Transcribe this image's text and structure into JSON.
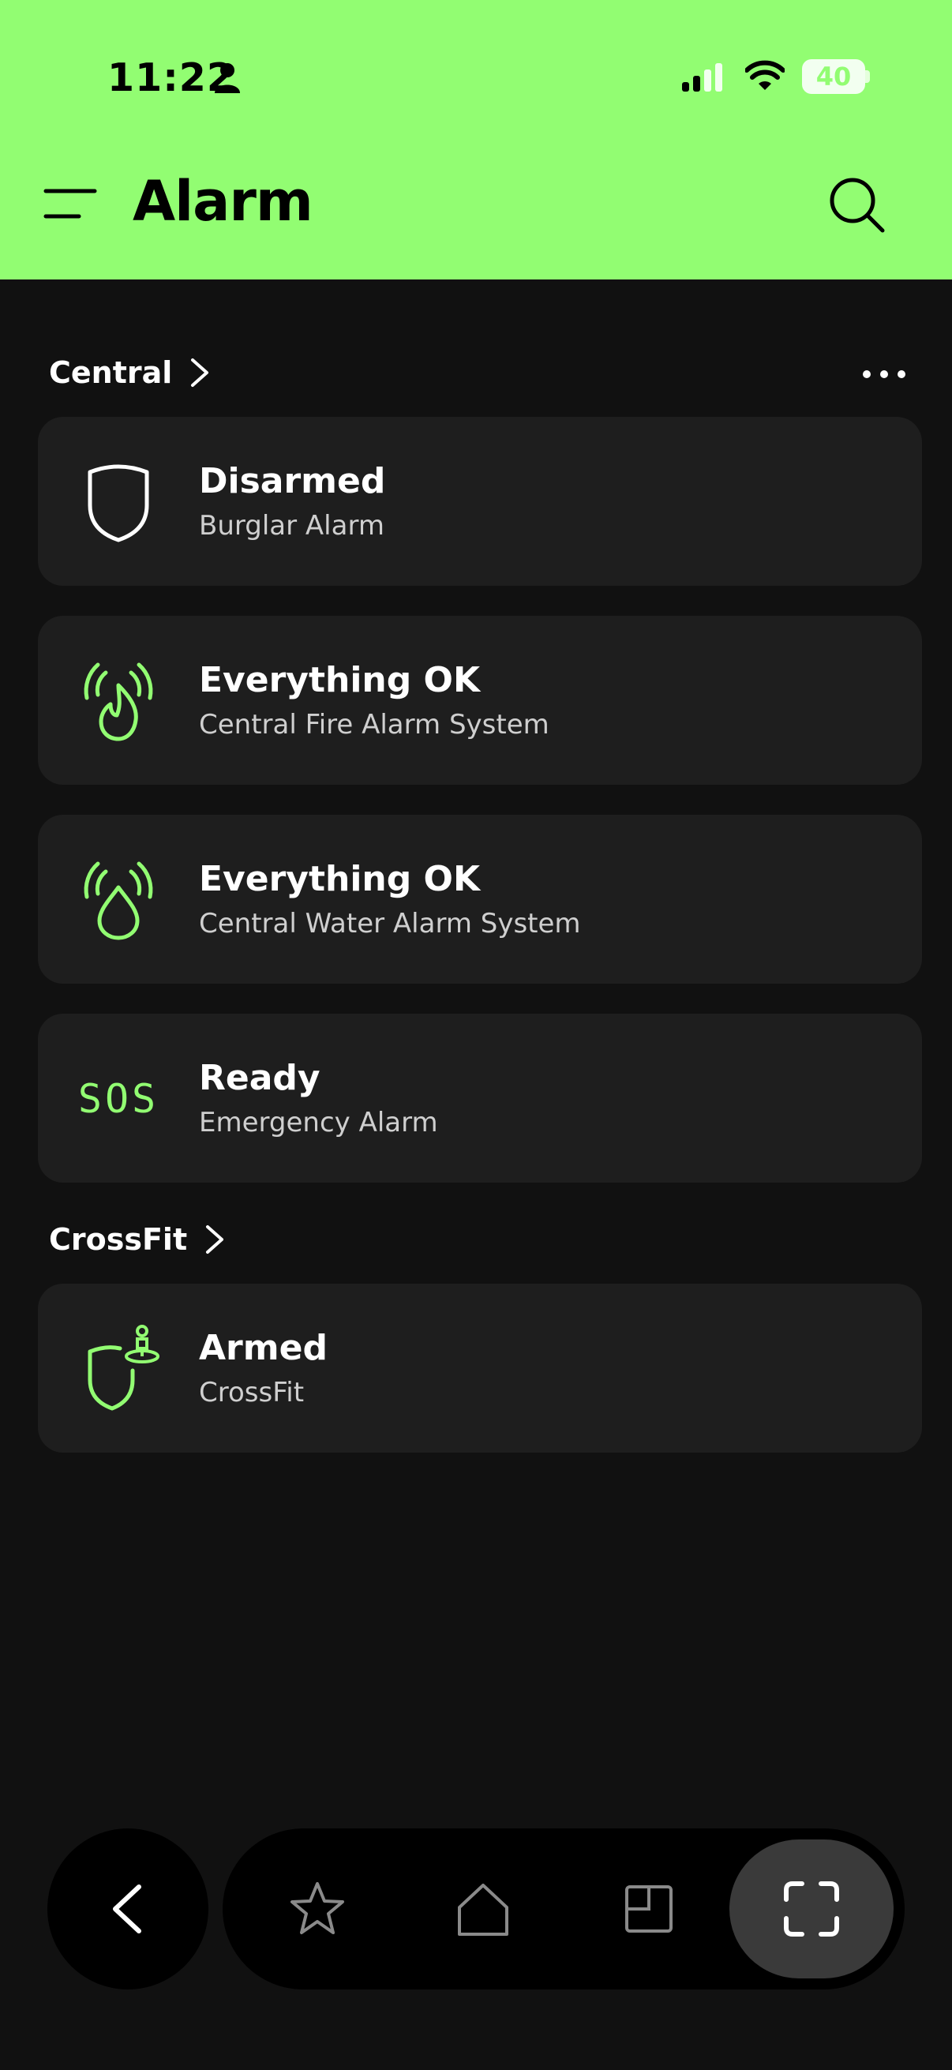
{
  "status_bar": {
    "time": "11:22",
    "battery": "40"
  },
  "header": {
    "title": "Alarm"
  },
  "sections": [
    {
      "label": "Central"
    },
    {
      "label": "CrossFit"
    }
  ],
  "cards": [
    {
      "title": "Disarmed",
      "subtitle": "Burglar Alarm",
      "icon": "shield-icon"
    },
    {
      "title": "Everything OK",
      "subtitle": "Central Fire Alarm System",
      "icon": "fire-alarm-icon"
    },
    {
      "title": "Everything OK",
      "subtitle": "Central Water Alarm System",
      "icon": "water-alarm-icon"
    },
    {
      "title": "Ready",
      "subtitle": "Emergency Alarm",
      "icon": "sos-icon",
      "icon_text": "SOS"
    },
    {
      "title": "Armed",
      "subtitle": "CrossFit",
      "icon": "armed-shield-icon"
    }
  ],
  "colors": {
    "accent": "#92fd72",
    "background": "#111111",
    "card": "#1e1e1e"
  },
  "nav": {
    "items": [
      "back-icon",
      "star-icon",
      "home-icon",
      "floorplan-icon",
      "scan-icon"
    ],
    "active": "scan-icon"
  }
}
